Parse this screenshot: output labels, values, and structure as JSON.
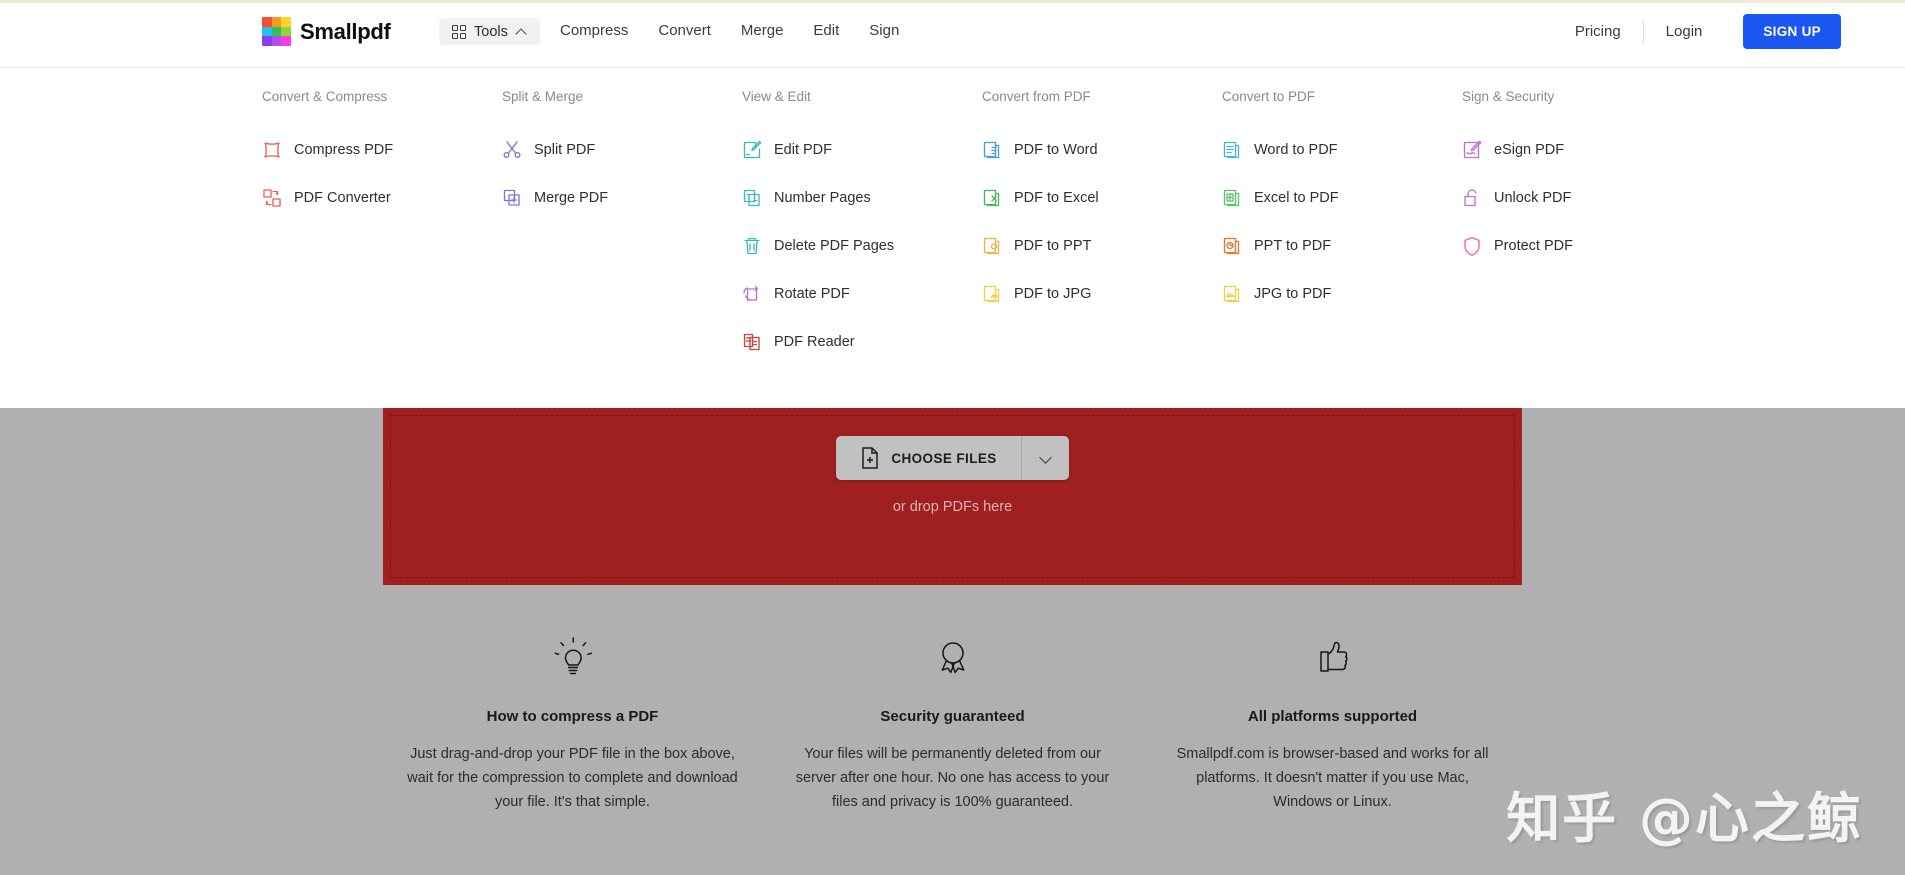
{
  "brand": {
    "name": "Smallpdf",
    "logo_colors": [
      "#f2522b",
      "#f79824",
      "#ffd12e",
      "#22c1e8",
      "#2fbf5d",
      "#8fd43a",
      "#8b3df2",
      "#b04ef5",
      "#f53ee0"
    ]
  },
  "header": {
    "tools_button": {
      "label": "Tools",
      "expanded": true
    },
    "nav": [
      {
        "label": "Compress"
      },
      {
        "label": "Convert"
      },
      {
        "label": "Merge"
      },
      {
        "label": "Edit"
      },
      {
        "label": "Sign"
      }
    ],
    "pricing_label": "Pricing",
    "login_label": "Login",
    "signup_label": "SIGN UP",
    "signup_color": "#1a56f0"
  },
  "dropdown": {
    "columns": [
      {
        "title": "Convert & Compress",
        "items": [
          {
            "label": "Compress PDF",
            "icon": "compress-pdf-icon",
            "color": "#e8604f"
          },
          {
            "label": "PDF Converter",
            "icon": "pdf-converter-icon",
            "color": "#e8604f"
          }
        ]
      },
      {
        "title": "Split & Merge",
        "items": [
          {
            "label": "Split PDF",
            "icon": "scissors-icon",
            "color": "#8b6fd4"
          },
          {
            "label": "Merge PDF",
            "icon": "merge-pdf-icon",
            "color": "#8b6fd4"
          }
        ]
      },
      {
        "title": "View & Edit",
        "items": [
          {
            "label": "Edit PDF",
            "icon": "edit-pdf-icon",
            "color": "#3fb8c4"
          },
          {
            "label": "Number Pages",
            "icon": "number-pages-icon",
            "color": "#3fb8c4"
          },
          {
            "label": "Delete PDF Pages",
            "icon": "trash-icon",
            "color": "#3fb8c4"
          },
          {
            "label": "Rotate PDF",
            "icon": "rotate-pdf-icon",
            "color": "#b273d6"
          },
          {
            "label": "PDF Reader",
            "icon": "pdf-reader-icon",
            "color": "#c8443c"
          }
        ]
      },
      {
        "title": "Convert from PDF",
        "items": [
          {
            "label": "PDF to Word",
            "icon": "pdf-to-word-icon",
            "color": "#4a9ed6"
          },
          {
            "label": "PDF to Excel",
            "icon": "pdf-to-excel-icon",
            "color": "#43b85f"
          },
          {
            "label": "PDF to PPT",
            "icon": "pdf-to-ppt-icon",
            "color": "#edb24a"
          },
          {
            "label": "PDF to JPG",
            "icon": "pdf-to-jpg-icon",
            "color": "#f0d04a"
          }
        ]
      },
      {
        "title": "Convert to PDF",
        "items": [
          {
            "label": "Word to PDF",
            "icon": "word-to-pdf-icon",
            "color": "#4ab6d6"
          },
          {
            "label": "Excel to PDF",
            "icon": "excel-to-pdf-icon",
            "color": "#5fc16a"
          },
          {
            "label": "PPT to PDF",
            "icon": "ppt-to-pdf-icon",
            "color": "#e8763a"
          },
          {
            "label": "JPG to PDF",
            "icon": "jpg-to-pdf-icon",
            "color": "#f0d04a"
          }
        ]
      },
      {
        "title": "Sign & Security",
        "items": [
          {
            "label": "eSign PDF",
            "icon": "esign-pdf-icon",
            "color": "#c06fd6"
          },
          {
            "label": "Unlock PDF",
            "icon": "unlock-icon",
            "color": "#c06fd6"
          },
          {
            "label": "Protect PDF",
            "icon": "shield-icon",
            "color": "#e8679a"
          }
        ]
      }
    ]
  },
  "dropzone": {
    "choose_files_label": "CHOOSE FILES",
    "drop_hint": "or drop PDFs here",
    "background_color": "#a01f1f"
  },
  "features": [
    {
      "icon": "lightbulb-icon",
      "title": "How to compress a PDF",
      "body": "Just drag-and-drop your PDF file in the box above, wait for the compression to complete and download your file. It's that simple."
    },
    {
      "icon": "award-ribbon-icon",
      "title": "Security guaranteed",
      "body": "Your files will be permanently deleted from our server after one hour. No one has access to your files and privacy is 100% guaranteed."
    },
    {
      "icon": "thumbs-up-icon",
      "title": "All platforms supported",
      "body": "Smallpdf.com is browser-based and works for all platforms. It doesn't matter if you use Mac, Windows or Linux."
    }
  ],
  "watermark": {
    "text": "知乎 @心之鲸"
  }
}
